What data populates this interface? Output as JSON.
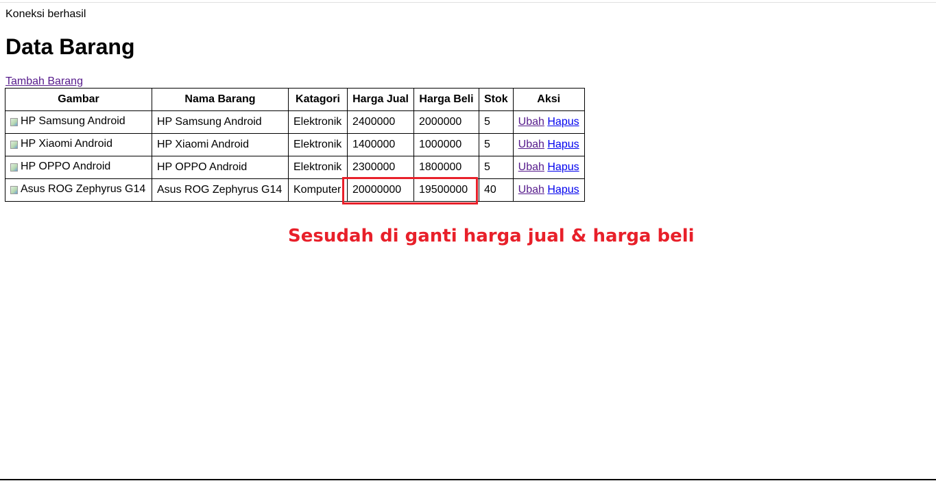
{
  "status_text": "Koneksi berhasil",
  "page_title": "Data Barang",
  "add_link_label": "Tambah Barang",
  "table": {
    "headers": [
      "Gambar",
      "Nama Barang",
      "Katagori",
      "Harga Jual",
      "Harga Beli",
      "Stok",
      "Aksi"
    ],
    "rows": [
      {
        "gambar_alt": "HP Samsung Android",
        "nama": "HP Samsung Android",
        "kategori": "Elektronik",
        "harga_jual": "2400000",
        "harga_beli": "2000000",
        "stok": "5",
        "ubah": "Ubah",
        "hapus": "Hapus"
      },
      {
        "gambar_alt": "HP Xiaomi Android",
        "nama": "HP Xiaomi Android",
        "kategori": "Elektronik",
        "harga_jual": "1400000",
        "harga_beli": "1000000",
        "stok": "5",
        "ubah": "Ubah",
        "hapus": "Hapus"
      },
      {
        "gambar_alt": "HP OPPO Android",
        "nama": "HP OPPO Android",
        "kategori": "Elektronik",
        "harga_jual": "2300000",
        "harga_beli": "1800000",
        "stok": "5",
        "ubah": "Ubah",
        "hapus": "Hapus"
      },
      {
        "gambar_alt": "Asus ROG Zephyrus G14",
        "nama": "Asus ROG Zephyrus G14",
        "kategori": "Komputer",
        "harga_jual": "20000000",
        "harga_beli": "19500000",
        "stok": "40",
        "ubah": "Ubah",
        "hapus": "Hapus"
      }
    ]
  },
  "annotation": {
    "text": "Sesudah di ganti harga jual & harga beli",
    "color": "#e8202a"
  },
  "colors": {
    "visited_link": "#551a8b",
    "link": "#0000ee"
  }
}
